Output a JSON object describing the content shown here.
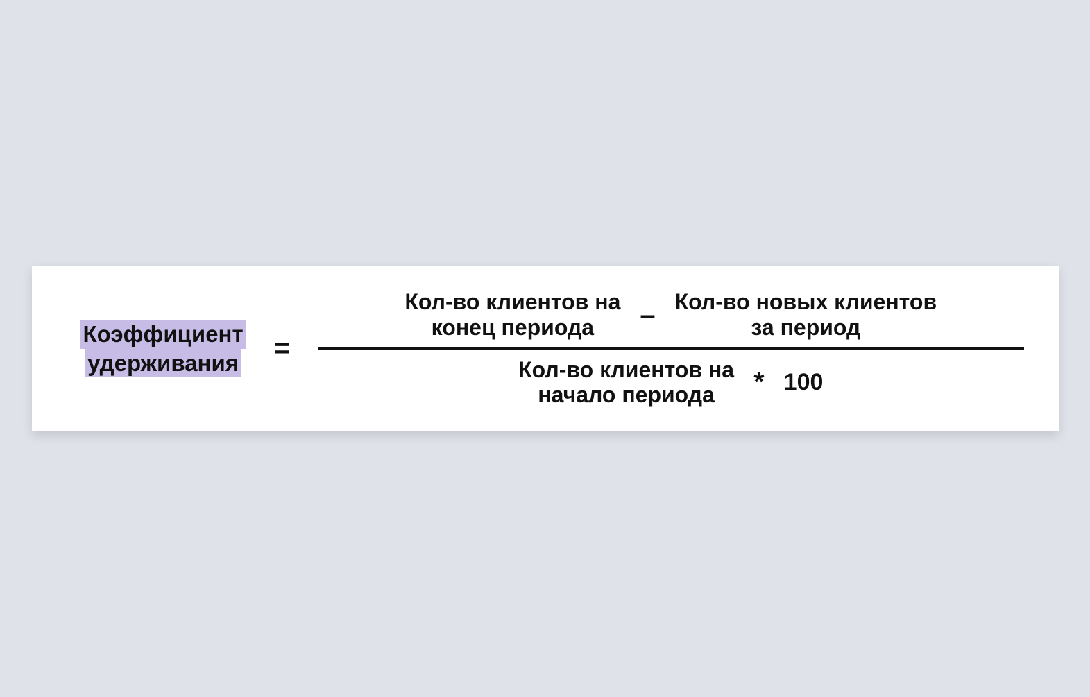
{
  "formula": {
    "lhs": {
      "line1": "Коэффициент",
      "line2": "удерживания"
    },
    "equals": "=",
    "numerator": {
      "term1": {
        "line1": "Кол-во клиентов на",
        "line2": "конец периода"
      },
      "minus": "–",
      "term2": {
        "line1": "Кол-во новых клиентов",
        "line2": "за период"
      }
    },
    "denominator": {
      "term": {
        "line1": "Кол-во клиентов на",
        "line2": "начало периода"
      },
      "times": "*",
      "factor": "100"
    }
  },
  "colors": {
    "highlight": "#c7bce5",
    "background": "#dfe2e9",
    "card": "#ffffff",
    "text": "#111111"
  }
}
